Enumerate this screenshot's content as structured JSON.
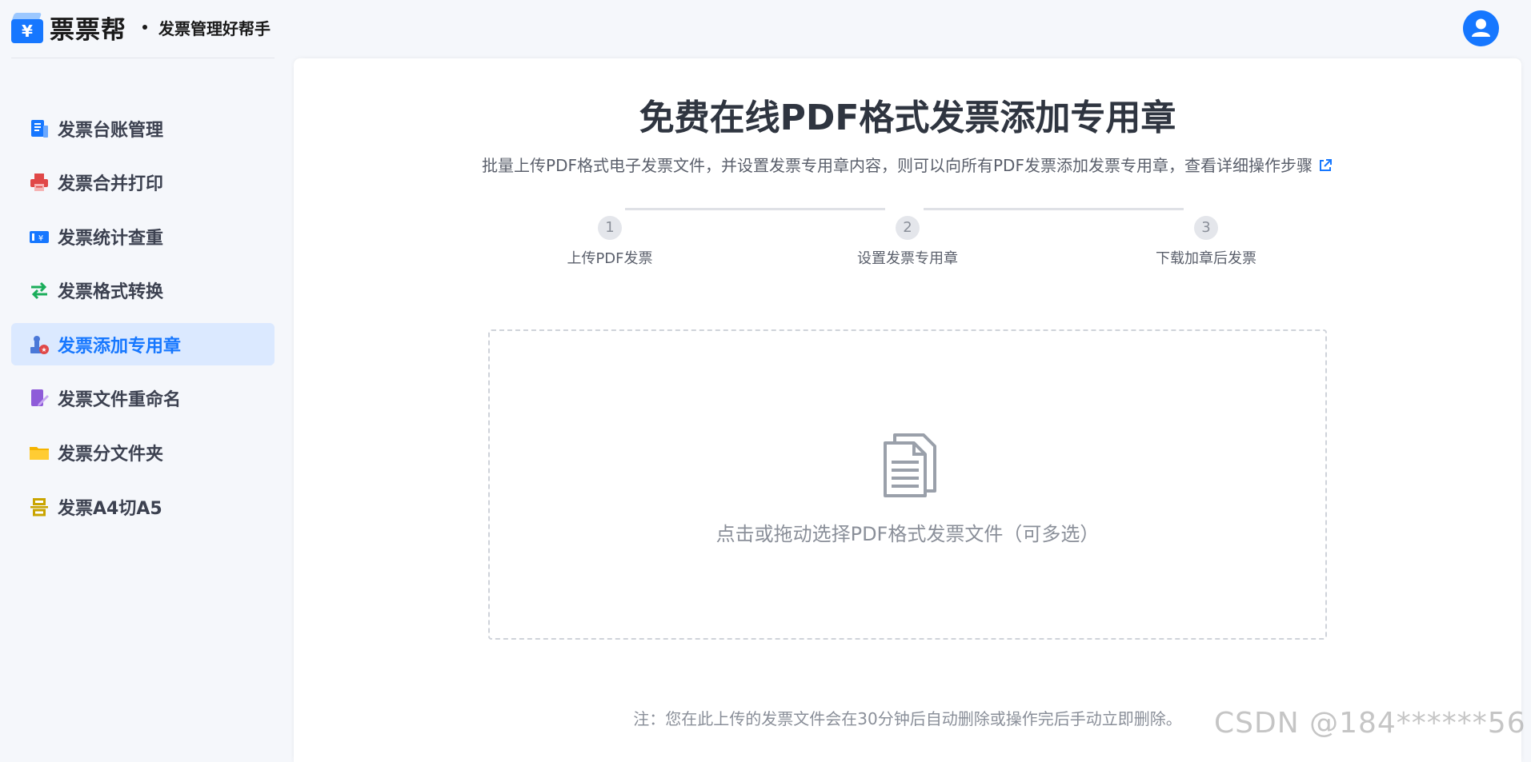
{
  "brand": {
    "logo_glyph": "¥",
    "name": "票票帮",
    "tagline": "发票管理好帮手",
    "accent": "#1677ff"
  },
  "sidebar": {
    "items": [
      {
        "label": "发票台账管理",
        "icon": "ledger-icon",
        "color": "#1677ff"
      },
      {
        "label": "发票合并打印",
        "icon": "printer-icon",
        "color": "#e04848"
      },
      {
        "label": "发票统计查重",
        "icon": "ticket-stats-icon",
        "color": "#1677ff"
      },
      {
        "label": "发票格式转换",
        "icon": "convert-arrows-icon",
        "color": "#1aad5a"
      },
      {
        "label": "发票添加专用章",
        "icon": "stamp-icon",
        "color": "#4a78d8",
        "active": true
      },
      {
        "label": "发票文件重命名",
        "icon": "rename-pen-icon",
        "color": "#8e5bd9"
      },
      {
        "label": "发票分文件夹",
        "icon": "folder-icon",
        "color": "#f5b400"
      },
      {
        "label": "发票A4切A5",
        "icon": "cut-paper-icon",
        "color": "#c9a400"
      }
    ]
  },
  "main": {
    "title": "免费在线PDF格式发票添加专用章",
    "subtitle": "批量上传PDF格式电子发票文件，并设置发票专用章内容，则可以向所有PDF发票添加发票专用章，查看详细操作步骤",
    "steps": [
      {
        "num": "1",
        "label": "上传PDF发票"
      },
      {
        "num": "2",
        "label": "设置发票专用章"
      },
      {
        "num": "3",
        "label": "下载加章后发票"
      }
    ],
    "dropzone": {
      "text": "点击或拖动选择PDF格式发票文件（可多选）",
      "icon": "documents-icon"
    },
    "note": "注：您在此上传的发票文件会在30分钟后自动删除或操作完后手动立即删除。"
  },
  "watermark": "CSDN @184******56"
}
